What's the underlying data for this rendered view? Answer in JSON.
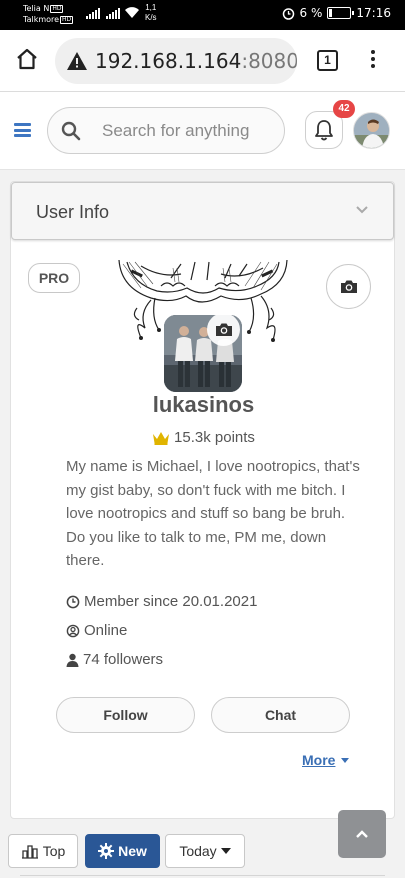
{
  "status_bar": {
    "carrier1": "Telia N",
    "carrier1_tag": "HD",
    "carrier2": "Talkmore",
    "carrier2_tag": "HD",
    "speed_value": "1,1",
    "speed_unit": "K/s",
    "battery": "6 %",
    "time": "17:16",
    "battery_level": 0.06
  },
  "browser": {
    "url_host": "192.168.1.164",
    "url_port": ":8080/",
    "tab_count": "1"
  },
  "header": {
    "search_placeholder": "Search for anything",
    "notification_count": "42"
  },
  "profile": {
    "section_title": "User Info",
    "badge": "PRO",
    "username": "lukasinos",
    "points": "15.3k points",
    "bio": "My name is Michael, I love nootropics, that's my gist baby, so don't fuck with me bitch. I love nootropics and stuff so bang be bruh. Do you like to talk to me, PM me, down there.",
    "member_since": "Member since 20.01.2021",
    "status": "Online",
    "followers": "74 followers",
    "follow_label": "Follow",
    "chat_label": "Chat",
    "more_label": "More"
  },
  "bottom_tabs": {
    "top_label": "Top",
    "new_label": "New",
    "period_label": "Today"
  },
  "colors": {
    "accent": "#2a5796",
    "link": "#3a6fb5",
    "badge_red": "#e64545",
    "crown_gold": "#e0b400"
  },
  "icons": [
    "home-icon",
    "warning-icon",
    "menu-dots-icon",
    "hamburger-icon",
    "search-icon",
    "bell-icon",
    "camera-icon",
    "crown-icon",
    "clock-icon",
    "user-circle-icon",
    "user-icon",
    "chevron-down-icon",
    "bar-chart-icon",
    "gear-icon",
    "caret-down-icon",
    "chevron-up-icon"
  ]
}
